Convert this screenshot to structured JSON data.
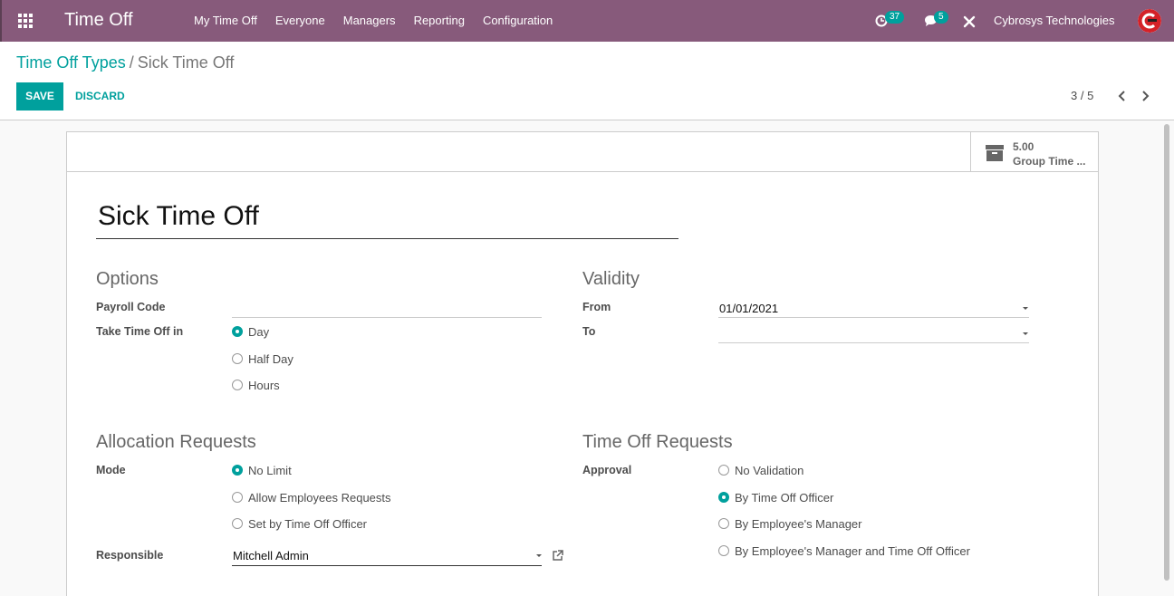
{
  "navbar": {
    "app_title": "Time Off",
    "menu": [
      "My Time Off",
      "Everyone",
      "Managers",
      "Reporting",
      "Configuration"
    ],
    "activity_count": "37",
    "messages_count": "5",
    "company": "Cybrosys Technologies"
  },
  "breadcrumb": {
    "parent": "Time Off Types",
    "separator": "/",
    "current": "Sick Time Off"
  },
  "buttons": {
    "save": "SAVE",
    "discard": "DISCARD"
  },
  "pager": {
    "value": "3 / 5"
  },
  "stat_button": {
    "value": "5.00",
    "label": "Group Time ..."
  },
  "form": {
    "name": "Sick Time Off",
    "options": {
      "title": "Options",
      "payroll_code_label": "Payroll Code",
      "payroll_code_value": "",
      "take_time_off_label": "Take Time Off in",
      "take_time_off_options": [
        "Day",
        "Half Day",
        "Hours"
      ],
      "take_time_off_selected": "Day"
    },
    "validity": {
      "title": "Validity",
      "from_label": "From",
      "from_value": "01/01/2021",
      "to_label": "To",
      "to_value": ""
    },
    "allocation": {
      "title": "Allocation Requests",
      "mode_label": "Mode",
      "mode_options": [
        "No Limit",
        "Allow Employees Requests",
        "Set by Time Off Officer"
      ],
      "mode_selected": "No Limit",
      "responsible_label": "Responsible",
      "responsible_value": "Mitchell Admin"
    },
    "time_off_requests": {
      "title": "Time Off Requests",
      "approval_label": "Approval",
      "approval_options": [
        "No Validation",
        "By Time Off Officer",
        "By Employee's Manager",
        "By Employee's Manager and Time Off Officer"
      ],
      "approval_selected": "By Time Off Officer"
    }
  },
  "colors": {
    "navbar": "#875a7b",
    "accent": "#00a09d"
  },
  "icons": [
    "apps-grid-icon",
    "activity-clock-icon",
    "chat-icon",
    "debug-tools-icon",
    "archive-box-icon",
    "external-link-icon",
    "chevron-left-icon",
    "chevron-right-icon"
  ]
}
